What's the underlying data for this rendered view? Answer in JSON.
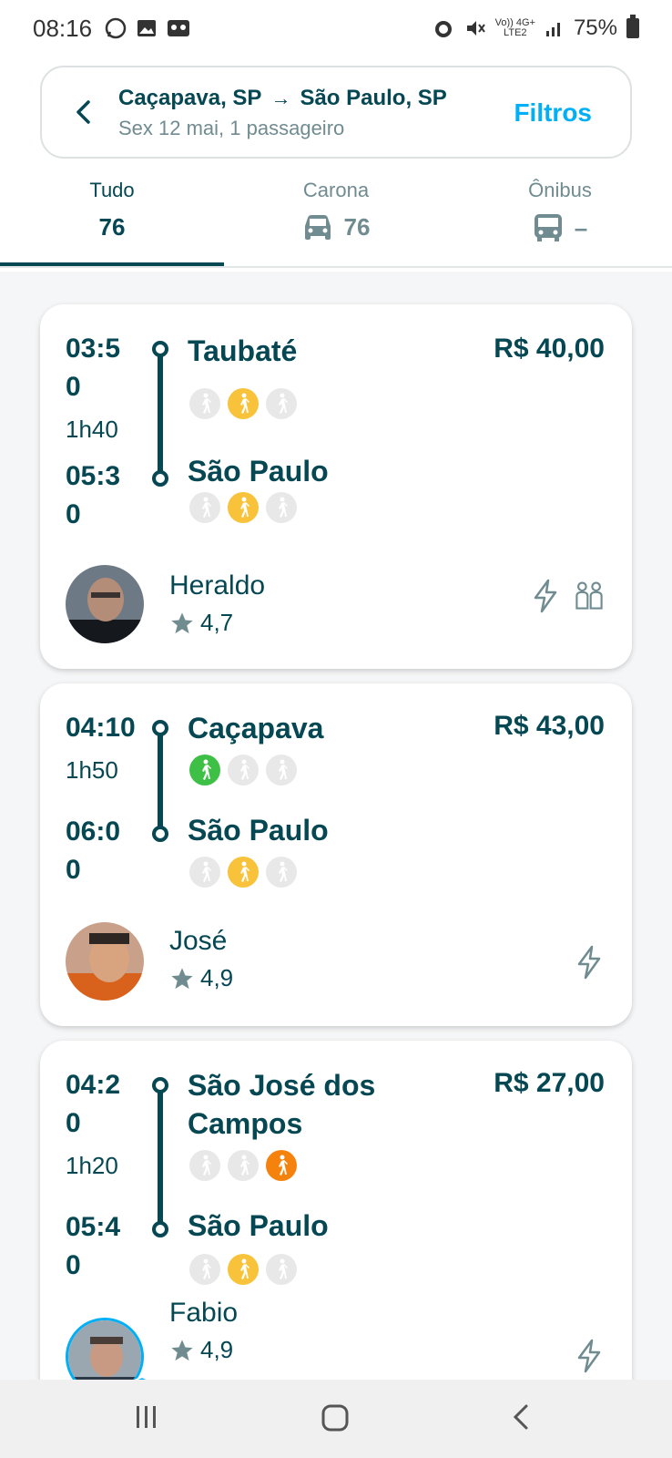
{
  "status_bar": {
    "time": "08:16",
    "battery": "75%",
    "net_small": "Vo)) 4G+",
    "net_small2": "LTE2"
  },
  "search": {
    "origin": "Caçapava, SP",
    "destination": "São Paulo, SP",
    "details": "Sex 12 mai, 1 passageiro",
    "filter_label": "Filtros"
  },
  "tabs": [
    {
      "label": "Tudo",
      "count": "76",
      "icon": null,
      "active": true
    },
    {
      "label": "Carona",
      "count": "76",
      "icon": "car-icon",
      "active": false
    },
    {
      "label": "Ônibus",
      "count": "–",
      "icon": "bus-icon",
      "active": false
    }
  ],
  "rides": [
    {
      "dep_time_l1": "03:5",
      "dep_time_l2": "0",
      "duration": "1h40",
      "from": "Taubaté",
      "arr_time_l1": "05:3",
      "arr_time_l2": "0",
      "to": "São Paulo",
      "price": "R$ 40,00",
      "from_proximity": [
        "none",
        "yellow",
        "none"
      ],
      "to_proximity": [
        "none",
        "yellow",
        "none"
      ],
      "driver": "Heraldo",
      "rating": "4,7",
      "icons": [
        "instant-booking-icon",
        "max-two-back-icon"
      ]
    },
    {
      "dep_time_l1": "04:10",
      "dep_time_l2": "",
      "duration": "1h50",
      "from": "Caçapava",
      "arr_time_l1": "06:0",
      "arr_time_l2": "0",
      "to": "São Paulo",
      "price": "R$ 43,00",
      "from_proximity": [
        "green",
        "none",
        "none"
      ],
      "to_proximity": [
        "none",
        "yellow",
        "none"
      ],
      "driver": "José",
      "rating": "4,9",
      "icons": [
        "instant-booking-icon"
      ]
    },
    {
      "dep_time_l1": "04:2",
      "dep_time_l2": "0",
      "duration": "1h20",
      "from_l1": "São José dos",
      "from_l2": "Campos",
      "arr_time_l1": "05:4",
      "arr_time_l2": "0",
      "to": "São Paulo",
      "price": "R$ 27,00",
      "from_proximity": [
        "none",
        "none",
        "orange"
      ],
      "to_proximity": [
        "none",
        "yellow",
        "none"
      ],
      "driver": "Fabio",
      "rating": "4,9",
      "icons": [
        "instant-booking-icon"
      ]
    }
  ],
  "colors": {
    "primary": "#054752",
    "accent": "#00aff5",
    "muted": "#708c91",
    "green": "#3ec046",
    "yellow": "#f8c33a",
    "orange": "#f5820d"
  }
}
